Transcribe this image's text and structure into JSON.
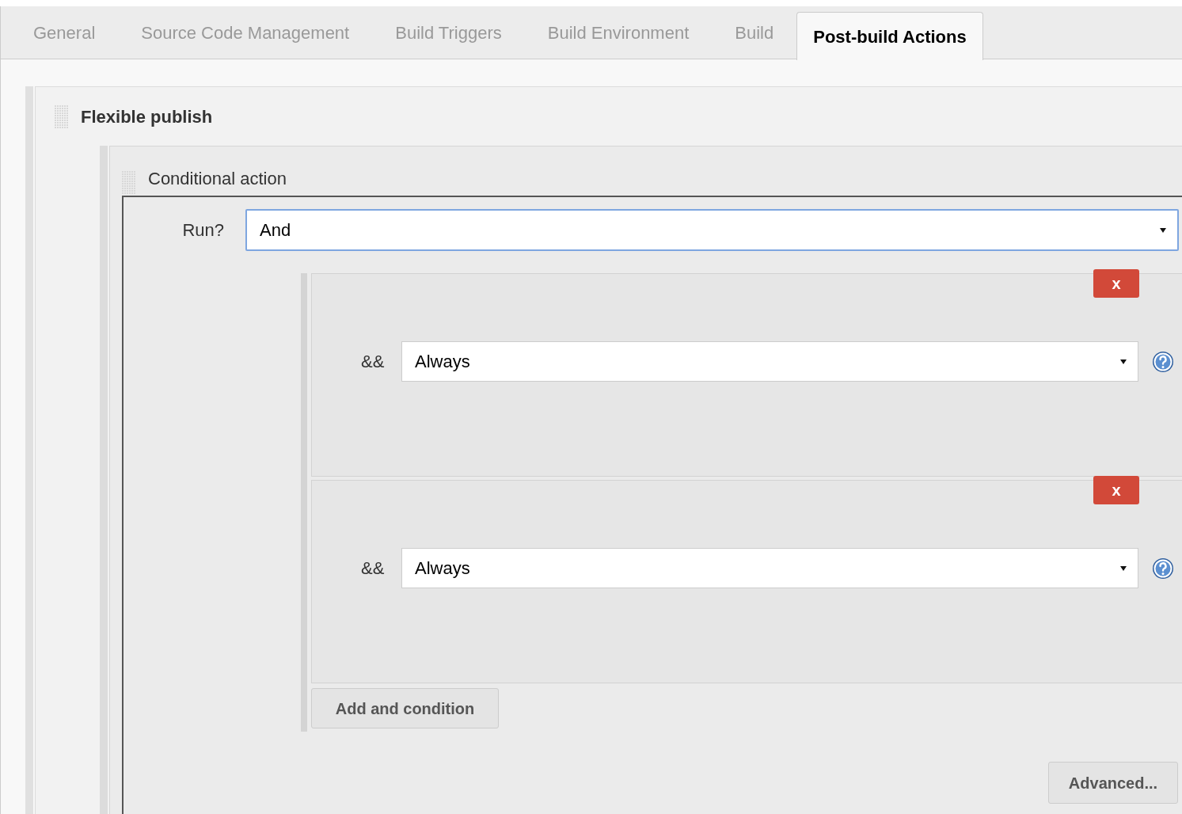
{
  "tabs": [
    {
      "label": "General",
      "selected": false
    },
    {
      "label": "Source Code Management",
      "selected": false
    },
    {
      "label": "Build Triggers",
      "selected": false
    },
    {
      "label": "Build Environment",
      "selected": false
    },
    {
      "label": "Build",
      "selected": false
    },
    {
      "label": "Post-build Actions",
      "selected": true
    }
  ],
  "section": {
    "title": "Flexible publish",
    "action": {
      "title": "Conditional action",
      "run": {
        "label": "Run?",
        "value": "And"
      },
      "conditions": [
        {
          "remove": "x",
          "label": "&&",
          "value": "Always"
        },
        {
          "remove": "x",
          "label": "&&",
          "value": "Always"
        }
      ],
      "add_button": "Add and condition",
      "advanced_button": "Advanced..."
    }
  }
}
